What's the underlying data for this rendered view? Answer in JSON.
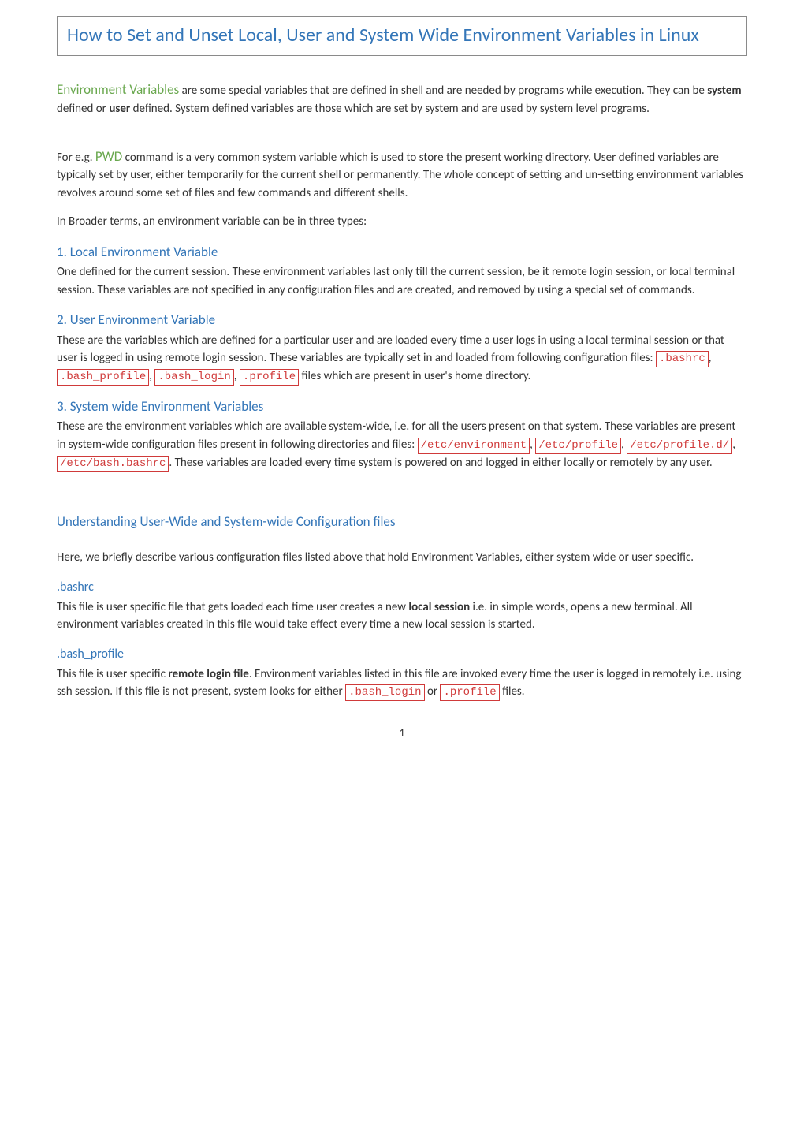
{
  "title": "How to Set and Unset Local, User and System Wide Environment Variables in Linux",
  "intro": {
    "envVarsLabel": "Environment Variables",
    "p1_a": " are some special variables that are defined in shell and are needed by programs while execution. They can be ",
    "p1_bold1": "system",
    "p1_b": " defined or ",
    "p1_bold2": "user",
    "p1_c": " defined. System defined variables are those which are set by system and are used by system level programs.",
    "p2_a": "For e.g. ",
    "pwdLabel": "PWD",
    "p2_b": " command is a very common system variable which is used to store the present working directory. User defined variables are typically set by user, either temporarily for the current shell or permanently. The whole concept of setting and un-setting environment variables revolves around some set of files and few commands and different shells.",
    "p3": "In Broader terms, an environment variable can be in three types:"
  },
  "sec1": {
    "h": "1. Local Environment Variable",
    "p": "One defined for the current session. These environment variables last only till the current session, be it remote login session, or local terminal session. These variables are not specified in any configuration files and are created, and removed by using a special set of commands."
  },
  "sec2": {
    "h": "2. User Environment Variable",
    "p1_a": "These are the variables which are defined for a particular user and are loaded every time a user logs in using a local terminal session or that user is logged in using remote login session. These variables are typically set in and loaded from following configuration files: ",
    "c1": ".bashrc",
    "sep": ", ",
    "c2": ".bash_profile",
    "c3": ".bash_login",
    "c4": ".profile",
    "p1_b": " files which are present in user's home directory."
  },
  "sec3": {
    "h": "3. System wide Environment Variables",
    "p1_a": "These are the environment variables which are available system-wide, i.e. for all the users present on that system. These variables are present in system-wide configuration files present in following directories and files: ",
    "c1": "/etc/environment",
    "sep": ", ",
    "c2": "/etc/profile",
    "c3": "/etc/profile.d/",
    "c4": "/etc/bash.bashrc",
    "p1_b": ". These variables are loaded every time system is powered on and logged in either locally or remotely by any user."
  },
  "understanding": {
    "h": "Understanding User-Wide and System-wide Configuration files",
    "p": "Here, we briefly describe various configuration files listed above that hold Environment Variables, either system wide or user specific."
  },
  "bashrc": {
    "h": ".bashrc",
    "p_a": "This file is user specific file that gets loaded each time user creates a new ",
    "bold": "local session",
    "p_b": " i.e. in simple words, opens a new terminal. All environment variables created in this file would take effect every time a new local session is started."
  },
  "bashprofile": {
    "h": ".bash_profile",
    "p_a": "This file is user specific ",
    "bold": "remote login file",
    "p_b": ". Environment variables listed in this file are invoked every time the user is logged in remotely i.e. using ssh session. If this file is not present, system looks for either ",
    "c1": ".bash_login",
    "or": " or ",
    "c2": ".profile",
    "p_c": " files."
  },
  "pageNum": "1"
}
